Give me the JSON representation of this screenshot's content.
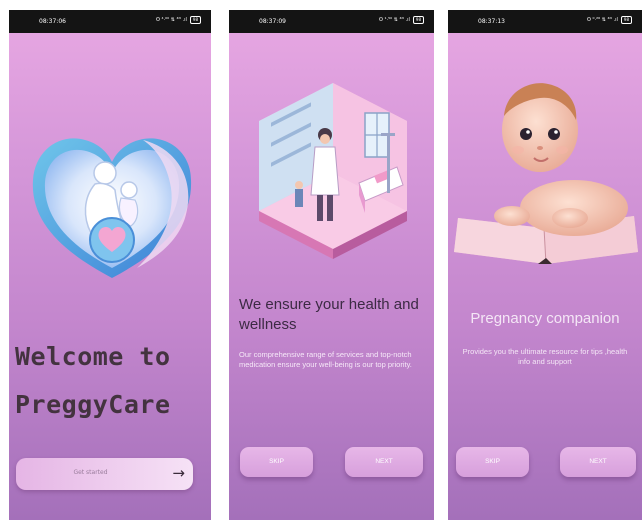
{
  "screens": {
    "welcome": {
      "time": "08:37:06",
      "status_icons": "ʘ ⁴·⁰⁰ ⇅ ⁴ᴳ .ıl",
      "battery": "98",
      "title_line1": "Welcome to",
      "title_line2": "PreggyCare",
      "button_label": "Get started",
      "arrow": "→"
    },
    "onboarding_health": {
      "time": "08:37:09",
      "status_icons": "ʘ ¹·⁵⁰ ⇅ ⁴ᴳ .ıl",
      "battery": "98",
      "heading": "We ensure your health and wellness",
      "description": "Our comprehensive range of services and top-notch medication ensure your well-being is our top priority.",
      "skip_label": "SKIP",
      "next_label": "NEXT"
    },
    "onboarding_companion": {
      "time": "08:37:13",
      "status_icons": "ʘ ⁰·²⁶ ⇅ ⁴ᴳ .ıl",
      "battery": "98",
      "heading": "Pregnancy companion",
      "description": "Provides you the ultimate resource for tips ,health info and support",
      "skip_label": "SKIP",
      "next_label": "NEXT"
    }
  },
  "colors": {
    "gradient_top": "#e8a8e3",
    "gradient_bottom": "#a470ba",
    "title_text": "#43333f",
    "status_bar": "#141414"
  }
}
